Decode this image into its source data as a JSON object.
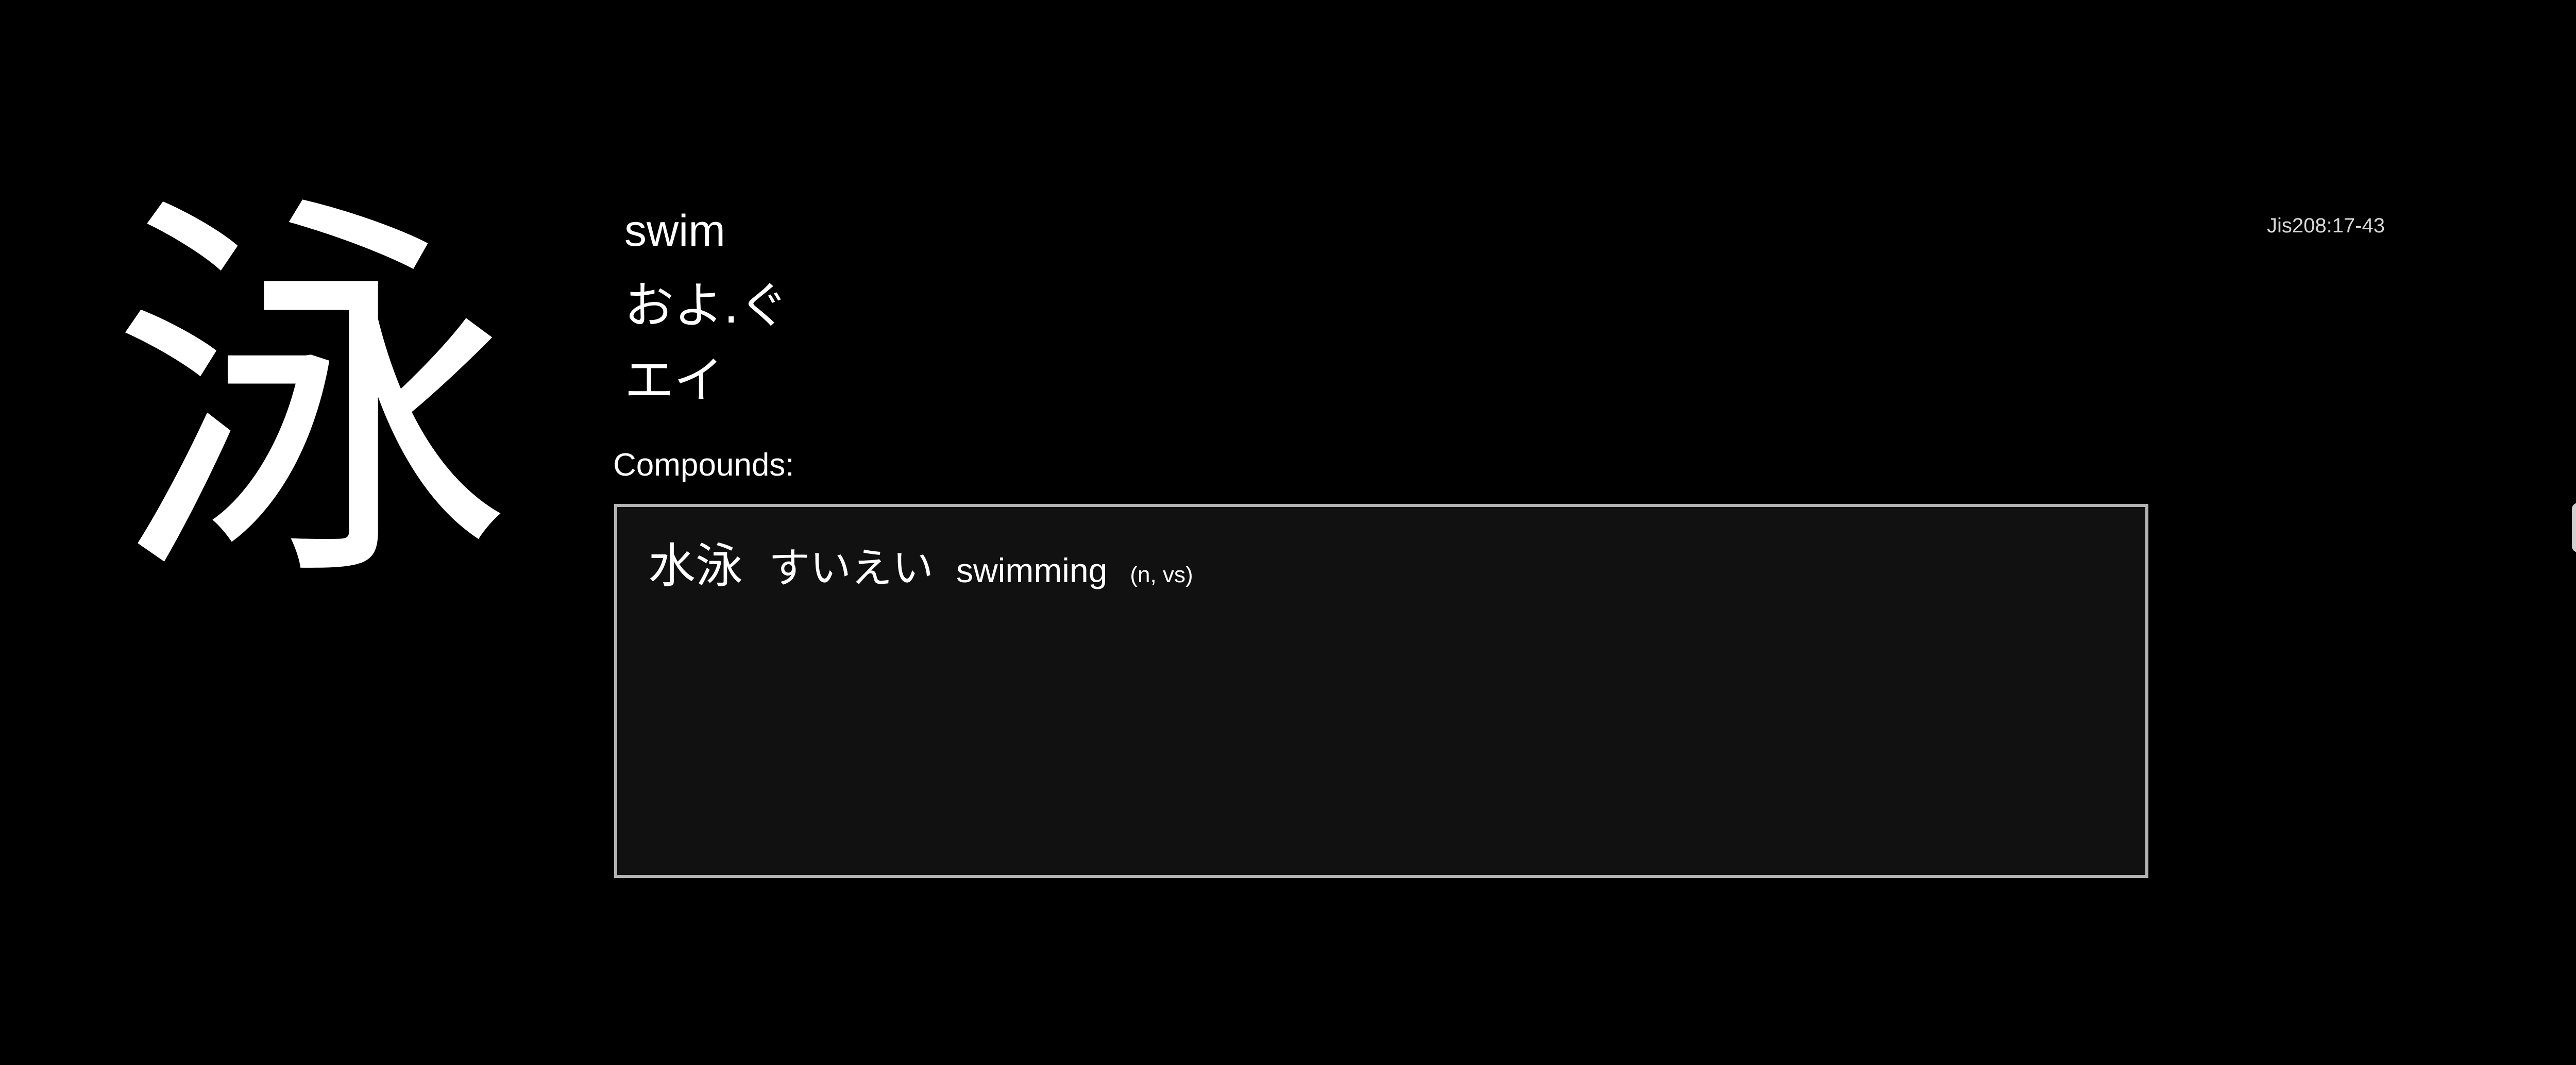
{
  "card": {
    "kanji": "泳",
    "meaning": "swim",
    "kun_reading": "およ.ぐ",
    "on_reading": "エイ",
    "jis_code": "Jis208:17-43"
  },
  "compounds": {
    "label": "Compounds:",
    "entries": [
      {
        "word": "水泳",
        "reading": "すいえい",
        "gloss": "swimming",
        "pos": "(n, vs)"
      }
    ]
  },
  "colors": {
    "background": "#000000",
    "text": "#ffffff",
    "box_background": "#111111",
    "box_border": "#b3b3b3"
  }
}
